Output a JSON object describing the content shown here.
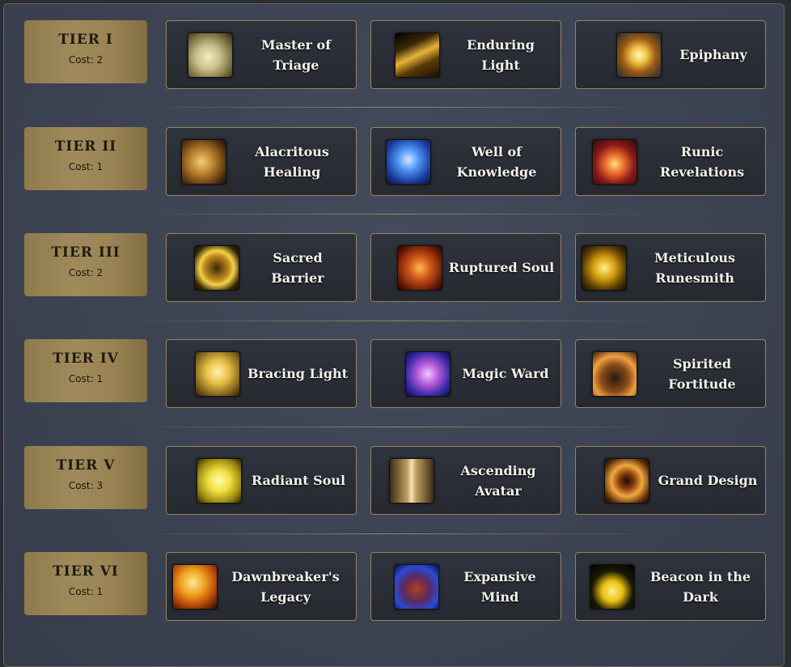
{
  "tiers": [
    {
      "name": "TIER I",
      "cost": "Cost: 2",
      "talents": [
        {
          "label": "Master of Triage",
          "icon": "praying-hands-icon"
        },
        {
          "label": "Enduring Light",
          "icon": "light-beam-icon"
        },
        {
          "label": "Epiphany",
          "icon": "golden-orb-icon"
        }
      ]
    },
    {
      "name": "TIER II",
      "cost": "Cost: 1",
      "talents": [
        {
          "label": "Alacritous Healing",
          "icon": "healing-hands-icon"
        },
        {
          "label": "Well of Knowledge",
          "icon": "blue-spirit-face-icon"
        },
        {
          "label": "Runic Revelations",
          "icon": "glowing-book-icon"
        }
      ]
    },
    {
      "name": "TIER III",
      "cost": "Cost: 2",
      "talents": [
        {
          "label": "Sacred Barrier",
          "icon": "golden-sphere-icon"
        },
        {
          "label": "Ruptured Soul",
          "icon": "fiery-rune-icon"
        },
        {
          "label": "Meticulous Runesmith",
          "icon": "rune-sigil-icon"
        }
      ]
    },
    {
      "name": "TIER IV",
      "cost": "Cost: 1",
      "talents": [
        {
          "label": "Bracing Light",
          "icon": "golden-crest-icon"
        },
        {
          "label": "Magic Ward",
          "icon": "scroll-icon"
        },
        {
          "label": "Spirited Fortitude",
          "icon": "hooded-figure-icon"
        }
      ]
    },
    {
      "name": "TIER V",
      "cost": "Cost: 3",
      "talents": [
        {
          "label": "Radiant Soul",
          "icon": "radiant-flame-icon"
        },
        {
          "label": "Ascending Avatar",
          "icon": "avatar-warrior-icon"
        },
        {
          "label": "Grand Design",
          "icon": "eye-icon"
        }
      ]
    },
    {
      "name": "TIER VI",
      "cost": "Cost: 1",
      "talents": [
        {
          "label": "Dawnbreaker's Legacy",
          "icon": "fire-orb-icon"
        },
        {
          "label": "Expansive Mind",
          "icon": "arcane-tome-icon"
        },
        {
          "label": "Beacon in the Dark",
          "icon": "glowing-silhouette-icon"
        }
      ]
    }
  ]
}
